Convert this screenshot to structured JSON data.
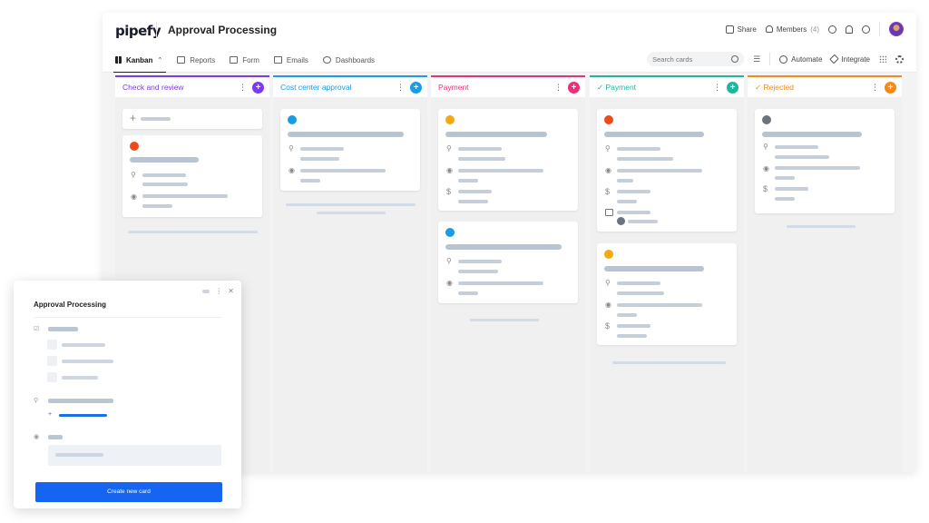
{
  "header": {
    "logo": "pipefy",
    "pipe_title": "Approval Processing",
    "share": "Share",
    "members": "Members",
    "members_count": "(4)"
  },
  "toolbar": {
    "tabs": [
      {
        "label": "Kanban",
        "icon": "kanban-icon"
      },
      {
        "label": "Reports",
        "icon": "table-icon"
      },
      {
        "label": "Form",
        "icon": "form-icon"
      },
      {
        "label": "Emails",
        "icon": "mail-icon"
      },
      {
        "label": "Dashboards",
        "icon": "dashboard-icon"
      }
    ],
    "search_placeholder": "Search cards",
    "automate": "Automate",
    "integrate": "Integrate"
  },
  "phases": [
    {
      "title": "Check and review",
      "color": "#7c3aed"
    },
    {
      "title": "Cost center approval",
      "color": "#1a9be6"
    },
    {
      "title": "Payment",
      "color": "#e8317a"
    },
    {
      "title": "✓ Payment",
      "color": "#22b59c"
    },
    {
      "title": "✓ Rejected",
      "color": "#f28a1d"
    }
  ],
  "card_dot_colors": {
    "red": "#f04a18",
    "blue": "#1a9be6",
    "yellow": "#f5a911",
    "gray": "#6c7380"
  },
  "modal": {
    "title": "Approval Processing",
    "create_button": "Create new card"
  }
}
